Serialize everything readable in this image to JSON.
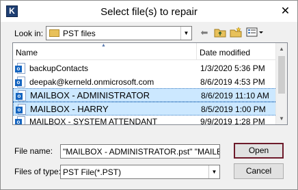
{
  "window": {
    "title": "Select file(s) to repair",
    "app_icon_letter": "K",
    "close_glyph": "✕"
  },
  "lookin": {
    "label": "Look in:",
    "value": "PST files"
  },
  "toolbar": {
    "icons": [
      "back-arrow-icon",
      "up-folder-icon",
      "new-folder-icon",
      "view-menu-icon"
    ]
  },
  "filelist": {
    "columns": [
      "Name",
      "Date modified"
    ],
    "rows": [
      {
        "name": "backupContacts",
        "date": "1/3/2020 5:36 PM",
        "selected": false
      },
      {
        "name": "deepak@kerneld.onmicrosoft.com",
        "date": "8/6/2019 4:53 PM",
        "selected": false
      },
      {
        "name": "MAILBOX - ADMINISTRATOR",
        "date": "8/6/2019 11:10 AM",
        "selected": true
      },
      {
        "name": "MAILBOX - HARRY",
        "date": "8/5/2019 1:00 PM",
        "selected": true
      },
      {
        "name": "MAILBOX - SYSTEM ATTENDANT",
        "date": "9/9/2019 1:28 PM",
        "selected": false
      }
    ]
  },
  "filename": {
    "label": "File name:",
    "value": "\"MAILBOX - ADMINISTRATOR.pst\" \"MAILBOX"
  },
  "filetype": {
    "label": "Files of type:",
    "value": "PST File(*.PST)"
  },
  "buttons": {
    "open": "Open",
    "cancel": "Cancel"
  },
  "colors": {
    "selection": "#cce8ff",
    "primary_border": "#6d1a2a",
    "app_icon": "#1f3f73"
  }
}
